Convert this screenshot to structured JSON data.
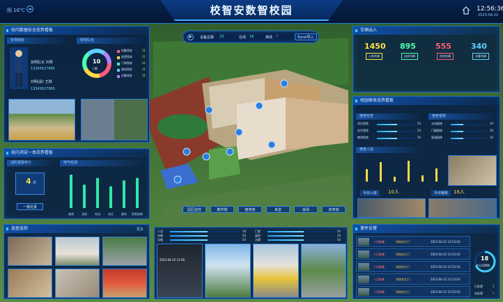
{
  "header": {
    "title": "校智安数智校园",
    "weather": "阴 16℃",
    "weather_icon": "cloud-icon",
    "time": "12:56:36",
    "date": "2023-04-22"
  },
  "stats_bar": {
    "total_label": "设备总数",
    "total": "23",
    "online_label": "在线",
    "online": "16",
    "offline_label": "离线",
    "offline": "7",
    "button": "Excel导入"
  },
  "panel_security": {
    "title": "校内数据安全态势看板",
    "sub_duty": "安保值班",
    "sub_team": "保安队伍",
    "person1_name": "张明队长 刘明",
    "person1_phone": "13345627895",
    "person2_name": "刘明(副)  王刚",
    "person2_phone": "13345627895",
    "donut_value": "10",
    "donut_unit": "人数",
    "legend": [
      {
        "label": "执勤保安",
        "value": "21"
      },
      {
        "label": "巡逻保安",
        "value": "21"
      },
      {
        "label": "门岗保安",
        "value": "21"
      },
      {
        "label": "夜班保安",
        "value": "21"
      },
      {
        "label": "后勤保安",
        "value": "21"
      }
    ]
  },
  "panel_fire": {
    "title": "校内消安一体态势看板",
    "sub_alarm": "消防报警统计",
    "sub_check": "电气检测",
    "alarm_value": "4",
    "alarm_unit": "次",
    "alarm_btn": "一键处置",
    "bars": [
      {
        "value": 40
      },
      {
        "value": 28
      },
      {
        "value": 36
      },
      {
        "value": 26
      },
      {
        "value": 33
      },
      {
        "value": 36
      }
    ],
    "labels": [
      "烟感",
      "温感",
      "电流",
      "电压",
      "漏电",
      "智能烟感"
    ]
  },
  "panel_visitors": {
    "title": "车辆出入",
    "kpis": [
      {
        "value": "1450",
        "label": "入校车辆",
        "color": "#ffe04a"
      },
      {
        "value": "895",
        "label": "出校车辆",
        "color": "#4dffb4"
      },
      {
        "value": "555",
        "label": "在校车辆",
        "color": "#ff5d7a"
      },
      {
        "value": "340",
        "label": "访客车辆",
        "color": "#5fd0ff"
      }
    ]
  },
  "panel_dorm": {
    "title": "校园宿舍态势看板",
    "sub_left": "宿舍检查",
    "sub_right": "宿舍报修",
    "left_rows": [
      {
        "label": "男生宿舍",
        "value": "54"
      },
      {
        "label": "女生宿舍",
        "value": "54"
      },
      {
        "label": "教师宿舍",
        "value": "54"
      }
    ],
    "right_rows": [
      {
        "label": "水电报修",
        "value": "34"
      },
      {
        "label": "门窗报修",
        "value": "34"
      },
      {
        "label": "家具报修",
        "value": "34"
      }
    ],
    "sub_chart": "宿舍入住",
    "chart": [
      {
        "value": 18
      },
      {
        "value": 28
      },
      {
        "value": 7
      },
      {
        "value": 30
      },
      {
        "value": 9
      },
      {
        "value": 19
      }
    ],
    "in_label": "今日入校",
    "in_value": "10人",
    "out_label": "今日离校",
    "out_value": "16人"
  },
  "panel_patrol": {
    "title": "巡查巡检",
    "more": "更多"
  },
  "panel_center": {
    "rows_left": [
      {
        "label": "人员",
        "value": "54"
      },
      {
        "label": "车辆",
        "value": "54"
      },
      {
        "label": "设备",
        "value": "54"
      }
    ],
    "rows_right": [
      {
        "label": "门禁",
        "value": "54"
      },
      {
        "label": "监控",
        "value": "54"
      },
      {
        "label": "访客",
        "value": "54"
      }
    ],
    "video_time": "2023-04-22 12:56"
  },
  "panel_events": {
    "title": "事件告警",
    "rows": [
      {
        "type": "人员聚集",
        "place": "学校东大门",
        "time": "2023-04-22 12:53:03"
      },
      {
        "type": "人员聚集",
        "place": "学校东大门",
        "time": "2023-04-22 12:53:03"
      },
      {
        "type": "人员聚集",
        "place": "学校东大门",
        "time": "2023-04-22 12:53:03"
      },
      {
        "type": "人员聚集",
        "place": "学校东大门",
        "time": "2023-04-22 12:53:03"
      },
      {
        "type": "人员聚集",
        "place": "学校东大门",
        "time": "2023-04-22 12:53:03"
      }
    ],
    "gauge_value": "18",
    "gauge_label": "今日告警数",
    "foot1_label": "已处理",
    "foot1": "2",
    "foot2_label": "未处理",
    "foot2": "2"
  },
  "map_buttons": [
    "园区监控",
    "教学楼",
    "宿舍楼",
    "食堂",
    "操场",
    "体育馆"
  ]
}
